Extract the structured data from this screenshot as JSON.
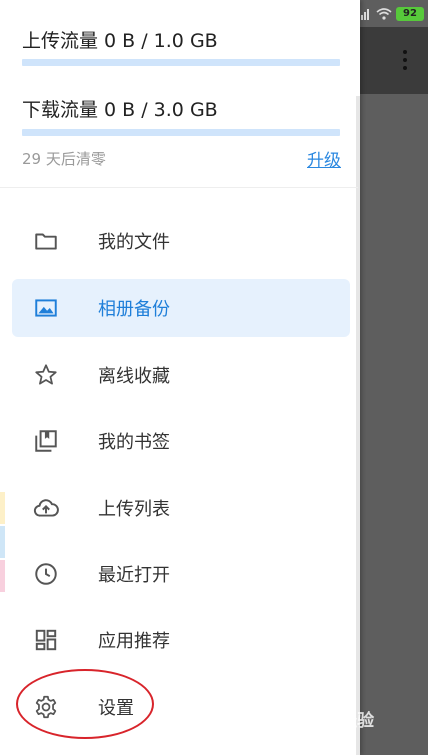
{
  "status_bar": {
    "battery": "92"
  },
  "quota": {
    "upload_label": "上传流量 0 B / 1.0 GB",
    "upload_fraction": 0,
    "download_label": "下载流量 0 B / 3.0 GB",
    "download_fraction": 0,
    "reset_text": "29 天后清零",
    "upgrade_label": "升级"
  },
  "menu": {
    "items": [
      {
        "label": "我的文件",
        "icon": "folder-icon",
        "active": false
      },
      {
        "label": "相册备份",
        "icon": "image-icon",
        "active": true
      },
      {
        "label": "离线收藏",
        "icon": "star-icon",
        "active": false
      },
      {
        "label": "我的书签",
        "icon": "bookmark-icon",
        "active": false
      },
      {
        "label": "上传列表",
        "icon": "cloud-upload-icon",
        "active": false
      },
      {
        "label": "最近打开",
        "icon": "clock-icon",
        "active": false
      },
      {
        "label": "应用推荐",
        "icon": "dashboard-icon",
        "active": false
      },
      {
        "label": "设置",
        "icon": "gear-icon",
        "active": false
      }
    ]
  },
  "watermark": {
    "text": "Bai 经验"
  },
  "colors": {
    "accent": "#2b88e0",
    "active_bg": "#e6f1fd",
    "annotation": "#d8242b",
    "battery": "#57c93b"
  }
}
